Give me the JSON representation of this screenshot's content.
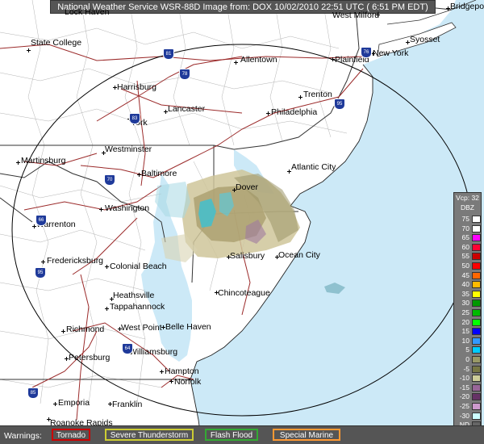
{
  "header": {
    "title": "National Weather Service WSR-88D Image from: DOX 10/02/2010 22:51 UTC ( 6:51 PM EDT)"
  },
  "cities": [
    {
      "name": "Bridgeport"
    },
    {
      "name": "Lock Haven"
    },
    {
      "name": "West Milford"
    },
    {
      "name": "State College"
    },
    {
      "name": "Syosset"
    },
    {
      "name": "Allentown"
    },
    {
      "name": "Plainfield"
    },
    {
      "name": "New York"
    },
    {
      "name": "Harrisburg"
    },
    {
      "name": "Trenton"
    },
    {
      "name": "Lancaster"
    },
    {
      "name": "Philadelphia"
    },
    {
      "name": "York"
    },
    {
      "name": "Westminster"
    },
    {
      "name": "Martinsburg"
    },
    {
      "name": "Baltimore"
    },
    {
      "name": "Atlantic City"
    },
    {
      "name": "Dover"
    },
    {
      "name": "Washington"
    },
    {
      "name": "Warrenton"
    },
    {
      "name": "Salisbury"
    },
    {
      "name": "Ocean City"
    },
    {
      "name": "Fredericksburg"
    },
    {
      "name": "Colonial Beach"
    },
    {
      "name": "Chincoteague"
    },
    {
      "name": "Heathsville"
    },
    {
      "name": "Tappahannock"
    },
    {
      "name": "Richmond"
    },
    {
      "name": "West Point"
    },
    {
      "name": "Belle Haven"
    },
    {
      "name": "Williamsburg"
    },
    {
      "name": "Petersburg"
    },
    {
      "name": "Hampton"
    },
    {
      "name": "Norfolk"
    },
    {
      "name": "Emporia"
    },
    {
      "name": "Franklin"
    },
    {
      "name": "Roanoke Rapids"
    }
  ],
  "highways": [
    "81",
    "78",
    "76",
    "95",
    "83",
    "70",
    "66",
    "95",
    "64",
    "85"
  ],
  "legend": {
    "mode_label": "Vcp: 32",
    "unit_label": "DBZ",
    "levels": [
      {
        "value": "75",
        "color": "#ffffff"
      },
      {
        "value": "70",
        "color": "#fffffe"
      },
      {
        "value": "65",
        "color": "#ff00ff"
      },
      {
        "value": "60",
        "color": "#ff0033"
      },
      {
        "value": "55",
        "color": "#cc0000"
      },
      {
        "value": "50",
        "color": "#ff0000"
      },
      {
        "value": "45",
        "color": "#ff6600"
      },
      {
        "value": "40",
        "color": "#ffbb00"
      },
      {
        "value": "35",
        "color": "#ffff00"
      },
      {
        "value": "30",
        "color": "#009900"
      },
      {
        "value": "25",
        "color": "#00bb00"
      },
      {
        "value": "20",
        "color": "#00ff00"
      },
      {
        "value": "15",
        "color": "#0000ff"
      },
      {
        "value": "10",
        "color": "#3399ff"
      },
      {
        "value": "5",
        "color": "#00ccff"
      },
      {
        "value": "0",
        "color": "#999966"
      },
      {
        "value": "-5",
        "color": "#777744"
      },
      {
        "value": "-10",
        "color": "#cccc99"
      },
      {
        "value": "-15",
        "color": "#996699"
      },
      {
        "value": "-20",
        "color": "#663366"
      },
      {
        "value": "-25",
        "color": "#cc99cc"
      },
      {
        "value": "-30",
        "color": "#ccffff"
      },
      {
        "value": "ND",
        "color": "#666666"
      }
    ]
  },
  "warnings": {
    "label": "Warnings:",
    "items": [
      {
        "label": "Tornado",
        "color": "#cc0000"
      },
      {
        "label": "Severe Thunderstorm",
        "color": "#cccc33"
      },
      {
        "label": "Flash Flood",
        "color": "#33aa33"
      },
      {
        "label": "Special Marine",
        "color": "#ff9933"
      }
    ]
  },
  "colors": {
    "ocean": "#cce9f7",
    "land": "#ffffff",
    "county_lines": "#aaaaaa",
    "state_lines": "#333333",
    "roads": "#9b2a2a",
    "range_ring": "#000000"
  }
}
